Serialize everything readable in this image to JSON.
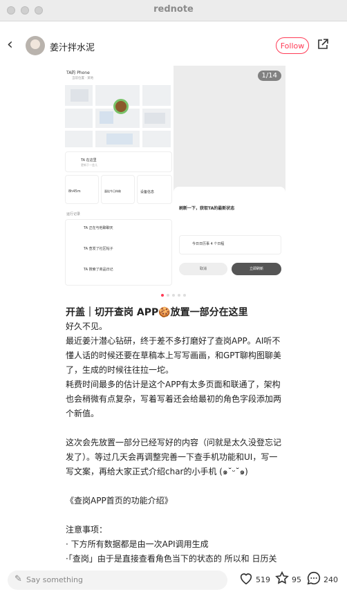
{
  "window": {
    "title": "rednote"
  },
  "header": {
    "back_icon": "←",
    "username": "姜汁拌水泥",
    "follow_label": "Follow",
    "share_icon": "⇱"
  },
  "carousel": {
    "page_indicator": "1/14",
    "left_screen": {
      "title": "TA的 Phone",
      "subtitle": "当前位置 · 某地",
      "loc_card_title": "TA 在这里",
      "loc_card_sub": "更新于一会儿",
      "tile1": "8h45m",
      "tile2": "蛋挞今日待做",
      "tile3": "设备信息",
      "log_title": "运行记录",
      "log1": "TA 正在与他聊聊天",
      "log2": "TA 查发了社区帖子",
      "log3": "TA 搜索了商品日记"
    },
    "right_sheet": {
      "title": "刷新一下，获取TA的最新状态",
      "card": "今日日历事 4 个日程",
      "cancel": "取消",
      "confirm": "立即刷新"
    }
  },
  "post": {
    "title": "开盖｜切开查岗 APP🍪放置一部分在这里",
    "paragraphs": [
      "好久不见。",
      "最近姜汁潜心钻研，终于差不多打磨好了查岗APP。AI听不懂人话的时候还要在草稿本上写写画画，和GPT聊构图聊美了，生成的时候往往拉一坨。",
      "耗费时间最多的估计是这个APP有太多页面和联通了，架构也会稍微有点复杂，写着写着还会给最初的角色字段添加两个新值。",
      "",
      "这次会先放置一部分已经写好的内容（问就是太久没登忘记发了）。等过几天会再调整完善一下查手机功能和UI，写一写文案，再给大家正式介绍char的小手机 (๑˘ᵕ˘๑)",
      "",
      "《查岗APP首页的功能介绍》",
      "",
      "注意事项：",
      "· 下方所有数据都是由一次API调用生成",
      "·「查岗」由于是直接查看角色当下的状态的 所以和 日历关联度极高。日历里生成的当日数据会直接成为char当下"
    ]
  },
  "bottom": {
    "comment_placeholder": "Say something",
    "likes": "519",
    "favorites": "95",
    "comments": "240"
  }
}
